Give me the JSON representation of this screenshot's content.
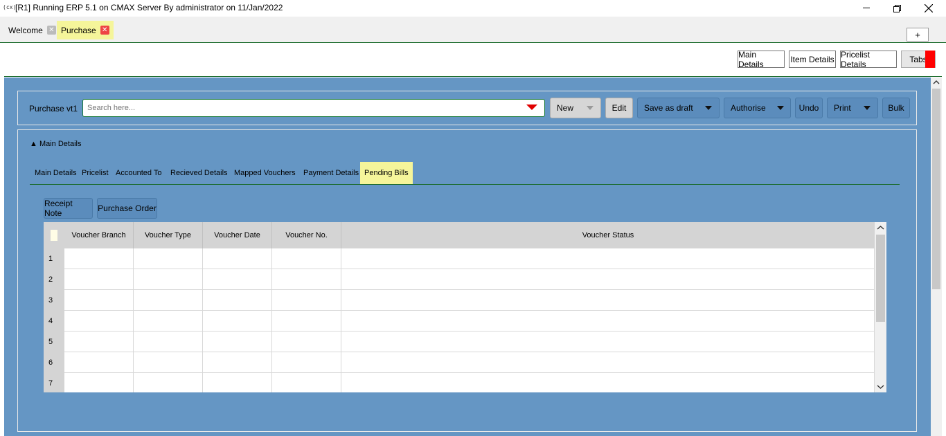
{
  "window": {
    "app_icon": "(cx)",
    "title": "[R1] Running ERP 5.1 on CMAX Server By administrator on 11/Jan/2022",
    "minimize_icon": "minimize-icon",
    "restore_icon": "restore-icon",
    "close_icon": "close-icon"
  },
  "doc_tabs": [
    {
      "label": "Welcome",
      "active": false
    },
    {
      "label": "Purchase",
      "active": true
    }
  ],
  "plus_label": "+",
  "top_nav": {
    "main_details": "Main Details",
    "item_details": "Item Details",
    "pricelist_details": "Pricelist Details",
    "tabs": "Tabs"
  },
  "toolbar": {
    "label": "Purchase vt1",
    "search_placeholder": "Search here...",
    "new": "New",
    "edit": "Edit",
    "save_as_draft": "Save as draft",
    "authorise": "Authorise",
    "undo": "Undo",
    "print": "Print",
    "bulk": "Bulk"
  },
  "details": {
    "header": "▲ Main Details",
    "tabs": [
      "Main Details",
      "Pricelist",
      "Accounted To",
      "Recieved Details",
      "Mapped Vouchers",
      "Payment Details",
      "Pending Bills"
    ],
    "active_tab": "Pending Bills",
    "buttons": {
      "receipt_note": "Receipt Note",
      "purchase_order": "Purchase Order"
    }
  },
  "grid": {
    "columns": [
      "Voucher Branch",
      "Voucher Type",
      "Voucher Date",
      "Voucher No.",
      "Voucher Status"
    ],
    "rows": [
      "1",
      "2",
      "3",
      "4",
      "5",
      "6",
      "7"
    ]
  },
  "colors": {
    "accent_green": "#1a6b2b",
    "panel_blue": "#6596c4",
    "active_tab_yellow": "#f5f59a",
    "close_red": "#e44"
  }
}
